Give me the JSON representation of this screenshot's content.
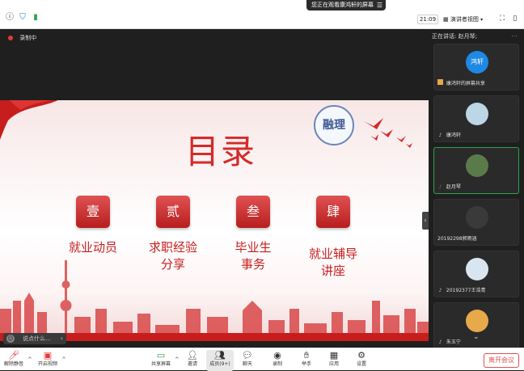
{
  "status_bar": {
    "share_banner": "您正在观看康鸿轩的屏幕",
    "time": "21:09",
    "view_mode": "演讲者视图"
  },
  "main": {
    "recording_label": "录制中",
    "chat_placeholder": "说点什么..."
  },
  "slide": {
    "title": "目录",
    "logo_text": "融理",
    "items": [
      {
        "numeral": "壹",
        "label_lines": [
          "就业动员"
        ]
      },
      {
        "numeral": "贰",
        "label_lines": [
          "求职经验",
          "分享"
        ]
      },
      {
        "numeral": "叁",
        "label_lines": [
          "毕业生",
          "事务"
        ]
      },
      {
        "numeral": "肆",
        "label_lines": [
          "就业辅导",
          "讲座"
        ]
      }
    ]
  },
  "panel": {
    "speaking_label": "正在讲话: 赵月琴;",
    "participants": [
      {
        "name": "康鸿轩的屏幕共享",
        "avatar_text": "鸿轩",
        "avatar_color": "#1e88e5",
        "active": false
      },
      {
        "name": "康鸿轩",
        "avatar_text": "",
        "avatar_color": "#bcd6e6",
        "active": false
      },
      {
        "name": "赵月琴",
        "avatar_text": "",
        "avatar_color": "#5b7a4a",
        "active": true
      },
      {
        "name": "20192298郭雨涵",
        "avatar_text": "",
        "avatar_color": "#3a3a3a",
        "active": false
      },
      {
        "name": "20192377王浩青",
        "avatar_text": "",
        "avatar_color": "#d9e6f2",
        "active": false
      },
      {
        "name": "朱玉宁",
        "avatar_text": "",
        "avatar_color": "#e8a94a",
        "active": false
      }
    ]
  },
  "toolbar": {
    "mute": "解除静音",
    "video": "开启视频",
    "share": "共享屏幕",
    "invite": "邀请",
    "members": "成员(9+)",
    "chat": "聊天",
    "record": "录制",
    "raise_hand": "举手",
    "apps": "应用",
    "settings": "设置",
    "leave": "离开会议"
  },
  "colors": {
    "accent_red": "#d42a2a",
    "active_green": "#2ea44f",
    "share_blue": "#1e88e5"
  }
}
